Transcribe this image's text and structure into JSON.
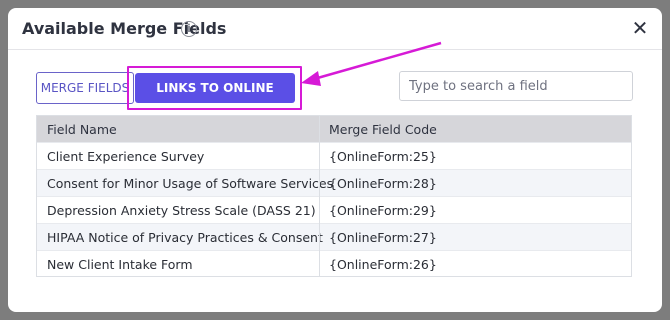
{
  "modal": {
    "title": "Available Merge Fields",
    "info_icon": "info-icon",
    "close_icon": "close-icon",
    "close_glyph": "✕"
  },
  "tabs": {
    "merge_fields_label": "MERGE FIELDS",
    "links_label": "LINKS TO ONLINE FORMS",
    "active": "LINKS TO ONLINE FORMS"
  },
  "search": {
    "placeholder": "Type to search a field",
    "value": ""
  },
  "table": {
    "headers": [
      "Field Name",
      "Merge Field Code"
    ],
    "rows": [
      {
        "name": "Client Experience Survey",
        "code": "{OnlineForm:25}"
      },
      {
        "name": "Consent for Minor Usage of Software Services",
        "code": "{OnlineForm:28}"
      },
      {
        "name": "Depression Anxiety Stress Scale (DASS 21)",
        "code": "{OnlineForm:29}"
      },
      {
        "name": "HIPAA Notice of Privacy Practices & Consent",
        "code": "{OnlineForm:27}"
      },
      {
        "name": "New Client Intake Form",
        "code": "{OnlineForm:26}"
      }
    ]
  },
  "colors": {
    "accent": "#5b4fe6",
    "annotation": "#d61ad6",
    "backdrop": "#7b7b7b"
  }
}
